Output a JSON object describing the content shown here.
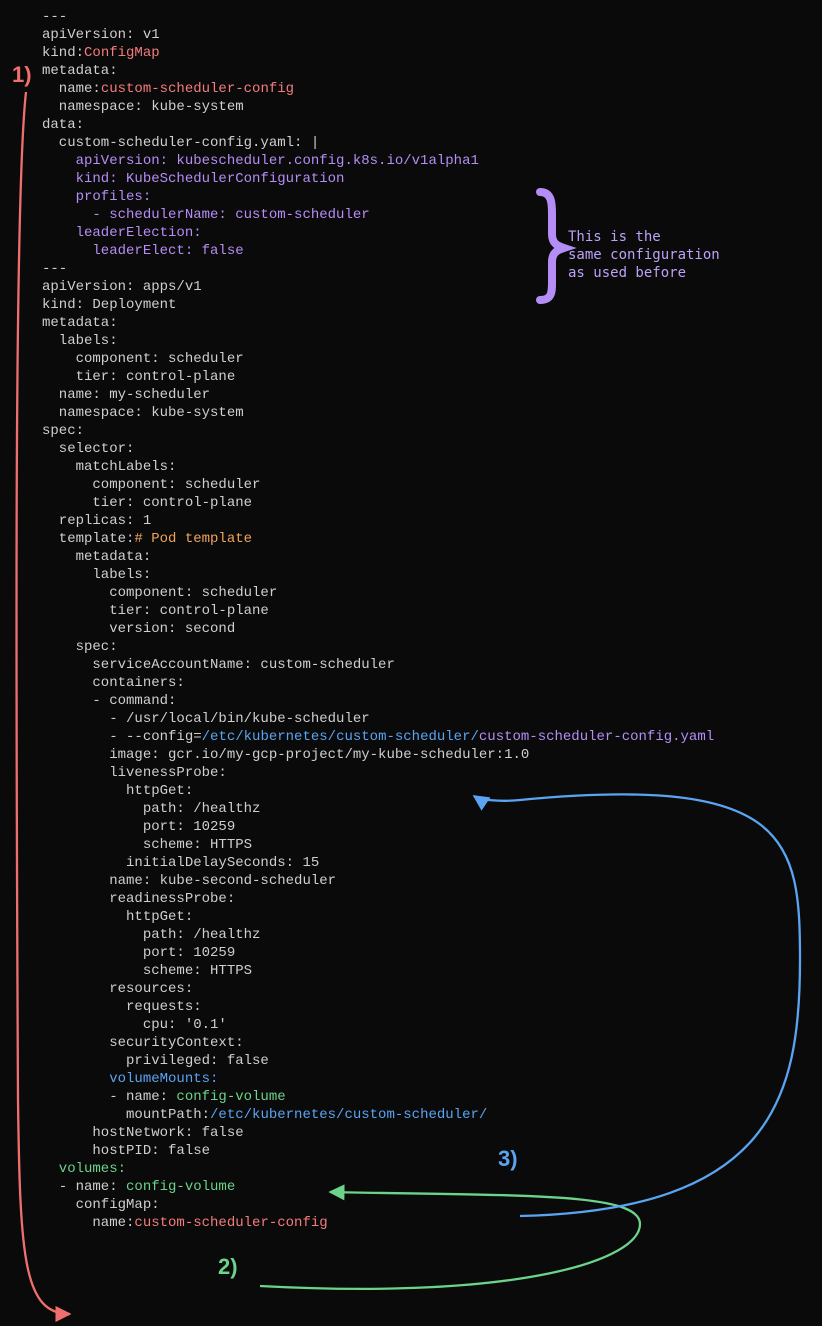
{
  "markers": {
    "one": "1)",
    "two": "2)",
    "three": "3)"
  },
  "note": {
    "line1": "This is the",
    "line2": "same configuration",
    "line3": "as used before"
  },
  "code": {
    "l01": "---",
    "l02": "apiVersion: v1",
    "l03a": "kind:",
    "l03b": "ConfigMap",
    "l04": "metadata:",
    "l05a": "  name:",
    "l05b": "custom-scheduler-config",
    "l06": "  namespace: kube-system",
    "l07": "data:",
    "l08": "  custom-scheduler-config.yaml: |",
    "l09": "    apiVersion: kubescheduler.config.k8s.io/v1alpha1",
    "l10": "    kind: KubeSchedulerConfiguration",
    "l11": "    profiles:",
    "l12": "      - schedulerName: custom-scheduler",
    "l13": "    leaderElection:",
    "l14": "      leaderElect: false",
    "l15": "---",
    "l16": "apiVersion: apps/v1",
    "l17": "kind: Deployment",
    "l18": "metadata:",
    "l19": "  labels:",
    "l20": "    component: scheduler",
    "l21": "    tier: control-plane",
    "l22": "  name: my-scheduler",
    "l23": "  namespace: kube-system",
    "l24": "spec:",
    "l25": "  selector:",
    "l26": "    matchLabels:",
    "l27": "      component: scheduler",
    "l28": "      tier: control-plane",
    "l29": "  replicas: 1",
    "l30a": "  template:",
    "l30b": "# Pod template",
    "l31": "    metadata:",
    "l32": "      labels:",
    "l33": "        component: scheduler",
    "l34": "        tier: control-plane",
    "l35": "        version: second",
    "l36": "    spec:",
    "l37": "      serviceAccountName: custom-scheduler",
    "l38": "      containers:",
    "l39": "      - command:",
    "l40": "        - /usr/local/bin/kube-scheduler",
    "l41a": "        - --config=",
    "l41b": "/etc/kubernetes/custom-scheduler/",
    "l41c": "custom-scheduler-config.yaml",
    "l42": "        image: gcr.io/my-gcp-project/my-kube-scheduler:1.0",
    "l43": "        livenessProbe:",
    "l44": "          httpGet:",
    "l45": "            path: /healthz",
    "l46": "            port: 10259",
    "l47": "            scheme: HTTPS",
    "l48": "          initialDelaySeconds: 15",
    "l49": "        name: kube-second-scheduler",
    "l50": "        readinessProbe:",
    "l51": "          httpGet:",
    "l52": "            path: /healthz",
    "l53": "            port: 10259",
    "l54": "            scheme: HTTPS",
    "l55": "        resources:",
    "l56": "          requests:",
    "l57": "            cpu: '0.1'",
    "l58": "        securityContext:",
    "l59": "          privileged: false",
    "l60": "        volumeMounts:",
    "l61a": "        - name: ",
    "l61b": "config-volume",
    "l62a": "          mountPath:",
    "l62b": "/etc/kubernetes/custom-scheduler/",
    "l63": "      hostNetwork: false",
    "l64": "      hostPID: false",
    "l65": "  volumes:",
    "l66a": "  - name: ",
    "l66b": "config-volume",
    "l67": "    configMap:",
    "l68a": "      name:",
    "l68b": "custom-scheduler-config"
  }
}
